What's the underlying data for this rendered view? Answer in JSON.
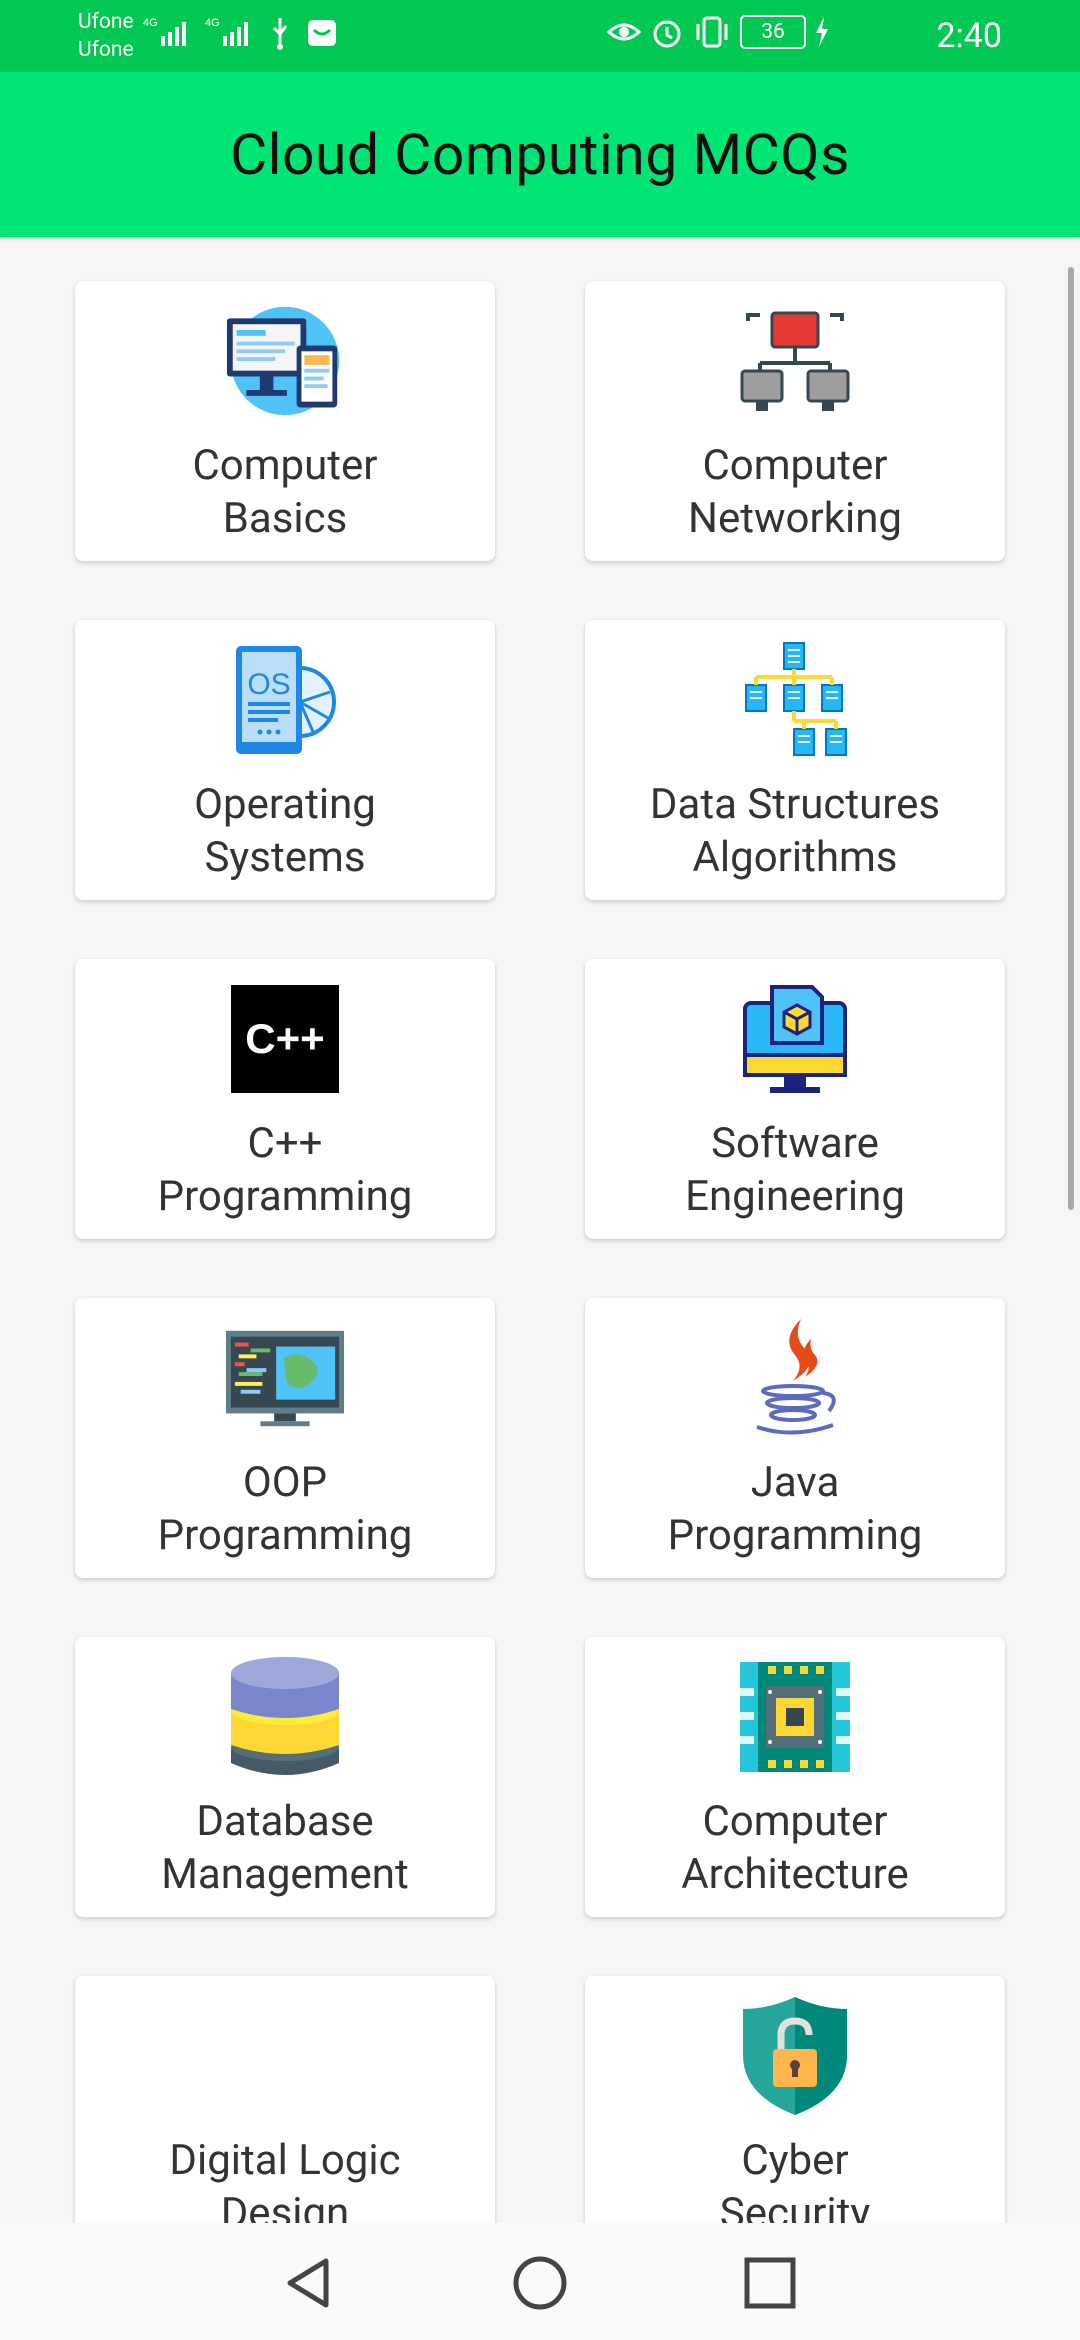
{
  "status_bar": {
    "carrier_1": "Ufone",
    "carrier_2": "Ufone",
    "network_1": "4G",
    "network_2": "4G",
    "battery": "36",
    "time": "2:40"
  },
  "app_bar": {
    "title": "Cloud Computing MCQs"
  },
  "cards": [
    {
      "label": "Computer\nBasics",
      "icon": "computer-basics-icon"
    },
    {
      "label": "Computer\nNetworking",
      "icon": "network-icon"
    },
    {
      "label": "Operating\nSystems",
      "icon": "os-icon"
    },
    {
      "label": "Data Structures\nAlgorithms",
      "icon": "data-structure-icon"
    },
    {
      "label": "C++\nProgramming",
      "icon": "cpp-icon"
    },
    {
      "label": "Software\nEngineering",
      "icon": "software-engineering-icon"
    },
    {
      "label": "OOP\nProgramming",
      "icon": "oop-icon"
    },
    {
      "label": "Java\nProgramming",
      "icon": "java-icon"
    },
    {
      "label": "Database\nManagement",
      "icon": "database-icon"
    },
    {
      "label": "Computer\nArchitecture",
      "icon": "chip-icon"
    },
    {
      "label": "Digital Logic\nDesign",
      "icon": ""
    },
    {
      "label": "Cyber\nSecurity",
      "icon": "security-shield-icon"
    }
  ],
  "nav": {
    "back": "back-icon",
    "home": "home-icon",
    "recents": "recents-icon"
  },
  "colors": {
    "status_bar": "#00c853",
    "app_bar": "#00e676",
    "background": "#f6f6f6"
  }
}
